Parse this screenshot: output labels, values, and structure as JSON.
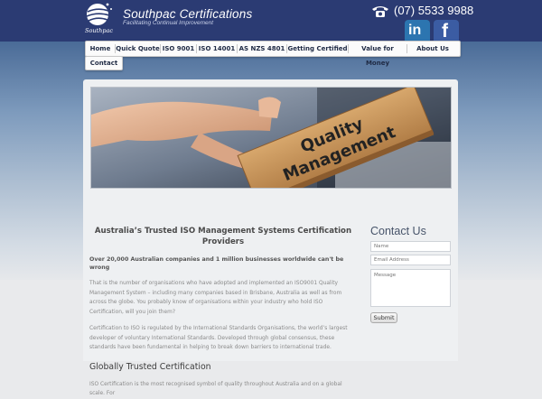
{
  "header": {
    "logo_word": "Southpac",
    "title": "Southpac Certifications",
    "tagline": "Facilitating Continual Improvement",
    "phone": "(07) 5533 9988",
    "phone_icon": "phone-icon",
    "social": [
      {
        "icon": "linkedin-icon",
        "glyph": "in",
        "color": "#2c75b0"
      },
      {
        "icon": "facebook-icon",
        "glyph": "f",
        "color": "#3b5ca3"
      }
    ]
  },
  "nav": {
    "items": [
      "Home",
      "Quick Quote",
      "ISO 9001",
      "ISO 14001",
      "AS NZS 4801",
      "Getting Certified",
      "Value for Money",
      "About Us"
    ],
    "overflow_item": "Contact"
  },
  "banner": {
    "stamp_line1": "Quality",
    "stamp_line2": "Management"
  },
  "main": {
    "heading": "Australia’s Trusted ISO Management Systems Certification Providers",
    "lead": "Over 20,000 Australian companies and 1 million businesses worldwide can't be wrong",
    "para1": "That is the number of organisations who have adopted and implemented an ISO9001 Quality Management System – including many companies based in Brisbane, Australia as well as from across the globe. You probably know of organisations within your industry who hold ISO Certification, will you join them?",
    "para2": "Certification to ISO is regulated by the International Standards Organisations, the world’s largest developer of voluntary International Standards. Developed through global consensus, these standards have been fundamental in helping to break down barriers to international trade.",
    "heading2": "Globally Trusted Certification",
    "para3": "ISO Certification is the most recognised symbol of quality throughout Australia and on a global scale. For"
  },
  "contact": {
    "heading": "Contact Us",
    "name_placeholder": "Name",
    "email_placeholder": "Email Address",
    "message_placeholder": "Message",
    "submit_label": "Submit"
  }
}
